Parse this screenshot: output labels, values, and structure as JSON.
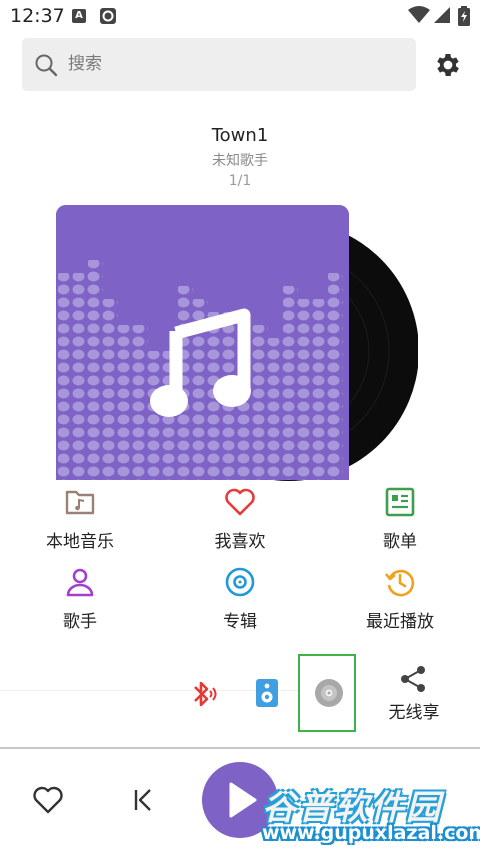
{
  "status_bar": {
    "time": "12:37",
    "a_badge": "A",
    "icons": [
      "a-badge-icon",
      "record-icon",
      "wifi-icon",
      "signal-icon",
      "battery-icon"
    ]
  },
  "search": {
    "placeholder": "搜索"
  },
  "track": {
    "title": "Town1",
    "artist": "未知歌手",
    "position": "1/1"
  },
  "grid": [
    {
      "label": "本地音乐",
      "icon": "folder-music-icon",
      "color": "#9a8175"
    },
    {
      "label": "我喜欢",
      "icon": "heart-icon",
      "color": "#e63b3b"
    },
    {
      "label": "歌单",
      "icon": "playlist-icon",
      "color": "#3f9e4d"
    },
    {
      "label": "歌手",
      "icon": "person-icon",
      "color": "#a23fcf"
    },
    {
      "label": "专辑",
      "icon": "album-icon",
      "color": "#1e9ad6"
    },
    {
      "label": "最近播放",
      "icon": "history-icon",
      "color": "#f2a11f"
    }
  ],
  "output_bar": {
    "share_label": "无线享",
    "selected": "cd-icon"
  },
  "colors": {
    "accent": "#7e62c6",
    "highlight_border": "#3db34a"
  },
  "watermark": {
    "name": "谷普软件园",
    "url": "www.gupuxlazal.com"
  }
}
